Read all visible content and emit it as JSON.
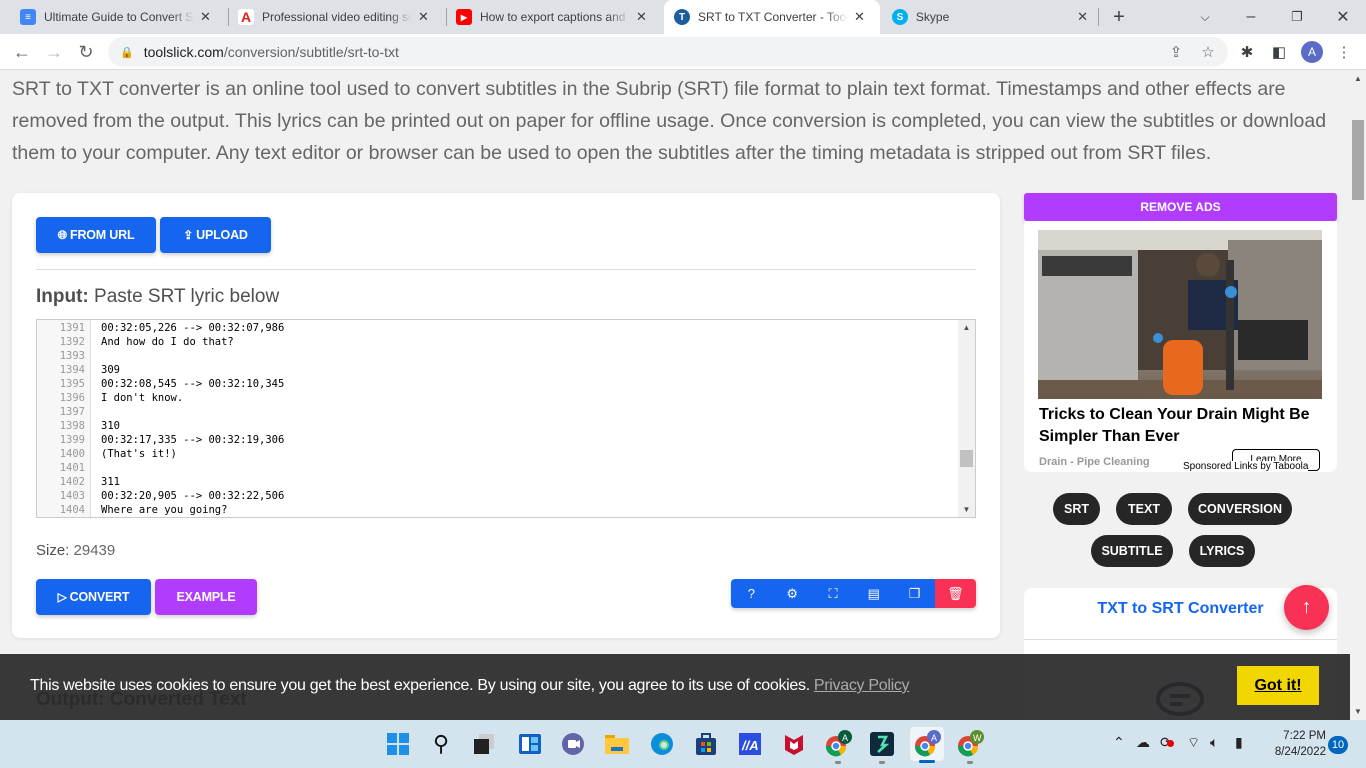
{
  "browser": {
    "tabs": [
      {
        "title": "Ultimate Guide to Convert SRT to TXT",
        "icon": "google-docs-icon",
        "active": false
      },
      {
        "title": "Professional video editing software",
        "icon": "adobe-icon",
        "active": false
      },
      {
        "title": "How to export captions and subtitles",
        "icon": "youtube-icon",
        "active": false
      },
      {
        "title": "SRT to TXT Converter - Tool Slick",
        "icon": "toolslick-icon",
        "active": true
      },
      {
        "title": "Skype",
        "icon": "skype-icon",
        "active": false
      }
    ],
    "new_tab_label": "+",
    "close_glyph": "✕",
    "url_domain": "toolslick.com",
    "url_path": "/conversion/subtitle/srt-to-txt",
    "avatar_letter": "A"
  },
  "page": {
    "intro": "SRT to TXT converter is an online tool used to convert subtitles in the Subrip (SRT) file format to plain text format. Timestamps and other effects are removed from the output. This lyrics can be printed out on paper for offline usage. Once conversion is completed, you can view the subtitles or download them to your computer. Any text editor or browser can be used to open the subtitles after the timing metadata is stripped out from SRT files.",
    "from_url_label": "FROM URL",
    "upload_label": "UPLOAD",
    "input_label_bold": "Input:",
    "input_label_rest": " Paste SRT lyric below",
    "editor_lines": [
      {
        "n": "1391",
        "text": "00:32:05,226 --> 00:32:07,986"
      },
      {
        "n": "1392",
        "text": "And how do I do that?"
      },
      {
        "n": "1393",
        "text": ""
      },
      {
        "n": "1394",
        "text": "309"
      },
      {
        "n": "1395",
        "text": "00:32:08,545 --> 00:32:10,345"
      },
      {
        "n": "1396",
        "text": "I don't know."
      },
      {
        "n": "1397",
        "text": ""
      },
      {
        "n": "1398",
        "text": "310"
      },
      {
        "n": "1399",
        "text": "00:32:17,335 --> 00:32:19,306"
      },
      {
        "n": "1400",
        "text": "(That's it!)"
      },
      {
        "n": "1401",
        "text": ""
      },
      {
        "n": "1402",
        "text": "311"
      },
      {
        "n": "1403",
        "text": "00:32:20,905 --> 00:32:22,506"
      },
      {
        "n": "1404",
        "text": "Where are you going?"
      }
    ],
    "size_label": "Size:",
    "size_value": "29439",
    "convert_label": "CONVERT",
    "example_label": "EXAMPLE",
    "output_label": "Output: Converted Text"
  },
  "sidebar": {
    "remove_ads_label": "REMOVE ADS",
    "ad": {
      "title": "Tricks to Clean Your Drain Might Be Simpler Than Ever",
      "source": "Drain - Pipe Cleaning",
      "cta": "Learn More",
      "sponsor": "Sponsored Links by Taboola"
    },
    "tags": [
      "SRT",
      "TEXT",
      "CONVERSION",
      "SUBTITLE",
      "LYRICS"
    ],
    "related_title": "TXT to SRT Converter"
  },
  "cookie": {
    "text": "This website uses cookies to ensure you get the best experience. By using our site, you agree to its use of cookies.",
    "link": "Privacy Policy",
    "button": "Got it!"
  },
  "taskbar": {
    "time": "7:22 PM",
    "date": "8/24/2022",
    "notifications": "10"
  }
}
